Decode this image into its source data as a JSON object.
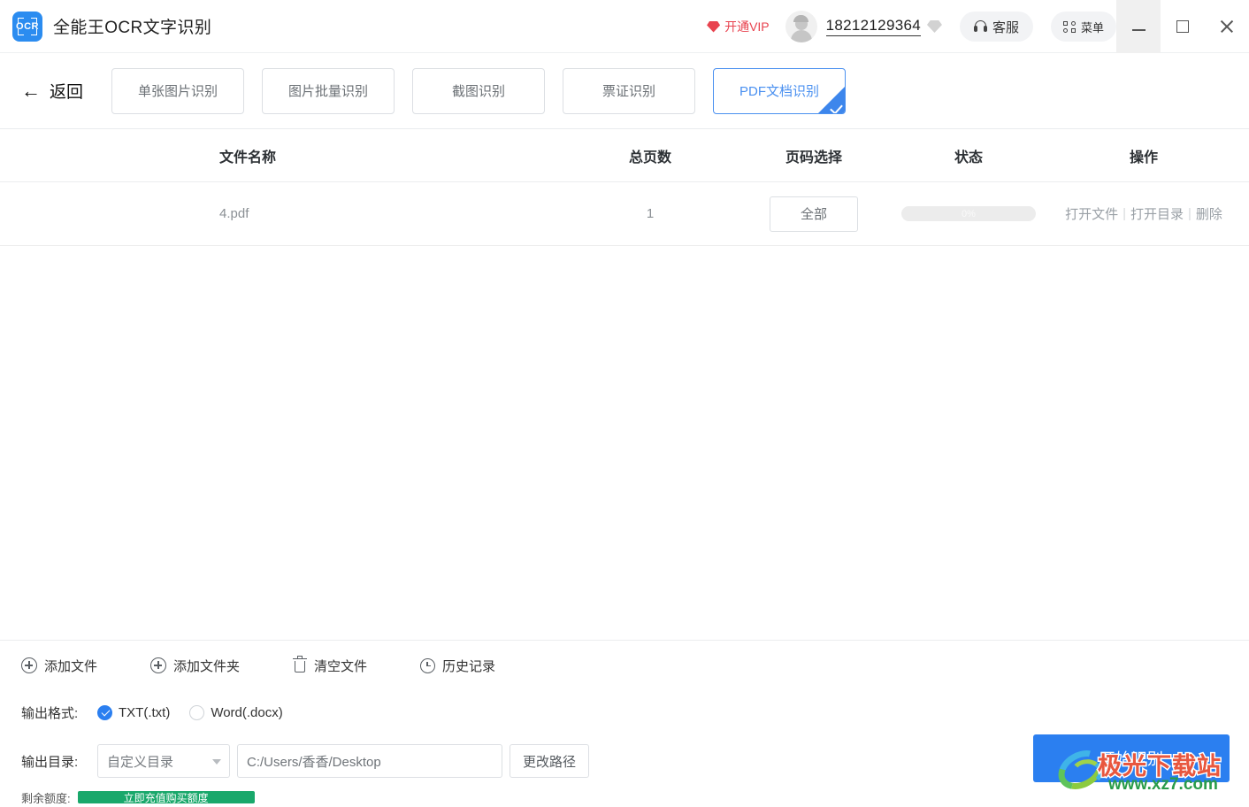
{
  "app": {
    "logo_text": "OCR",
    "title": "全能王OCR文字识别"
  },
  "header": {
    "vip_label": "开通VIP",
    "phone": "18212129364",
    "support_label": "客服",
    "menu_label": "菜单",
    "minimize": "—",
    "maximize": "□",
    "close": "✕"
  },
  "nav": {
    "back_label": "返回",
    "back_arrow": "←",
    "tabs": [
      {
        "label": "单张图片识别",
        "active": false
      },
      {
        "label": "图片批量识别",
        "active": false
      },
      {
        "label": "截图识别",
        "active": false
      },
      {
        "label": "票证识别",
        "active": false
      },
      {
        "label": "PDF文档识别",
        "active": true
      }
    ]
  },
  "table": {
    "columns": {
      "name": "文件名称",
      "pages": "总页数",
      "page_select": "页码选择",
      "status": "状态",
      "actions": "操作"
    },
    "rows": [
      {
        "name": "4.pdf",
        "pages": "1",
        "page_select": "全部",
        "progress_text": "0%",
        "progress_percent": 0,
        "action_open_file": "打开文件",
        "action_open_dir": "打开目录",
        "action_delete": "删除",
        "separator": "|"
      }
    ]
  },
  "toolbar": {
    "add_file": "添加文件",
    "add_folder": "添加文件夹",
    "clear_files": "清空文件",
    "history": "历史记录"
  },
  "output_format": {
    "label": "输出格式:",
    "options": [
      {
        "label": "TXT(.txt)",
        "selected": true
      },
      {
        "label": "Word(.docx)",
        "selected": false
      }
    ]
  },
  "output_dir": {
    "label": "输出目录:",
    "mode_selected": "自定义目录",
    "path_value": "C:/Users/香香/Desktop",
    "change_path_label": "更改路径"
  },
  "start_button": {
    "label": "开始识别"
  },
  "quota": {
    "label": "剩余额度:",
    "bar_text": "立即充值购买额度"
  },
  "watermark": {
    "site_name": "极光下载站",
    "url": "www.xz7.com"
  },
  "colors": {
    "accent_blue": "#2b7ff0",
    "tab_active_blue": "#4a90f0",
    "vip_red": "#e8434f",
    "text_dark": "#2c3034",
    "text_gray": "#8a8f94"
  }
}
